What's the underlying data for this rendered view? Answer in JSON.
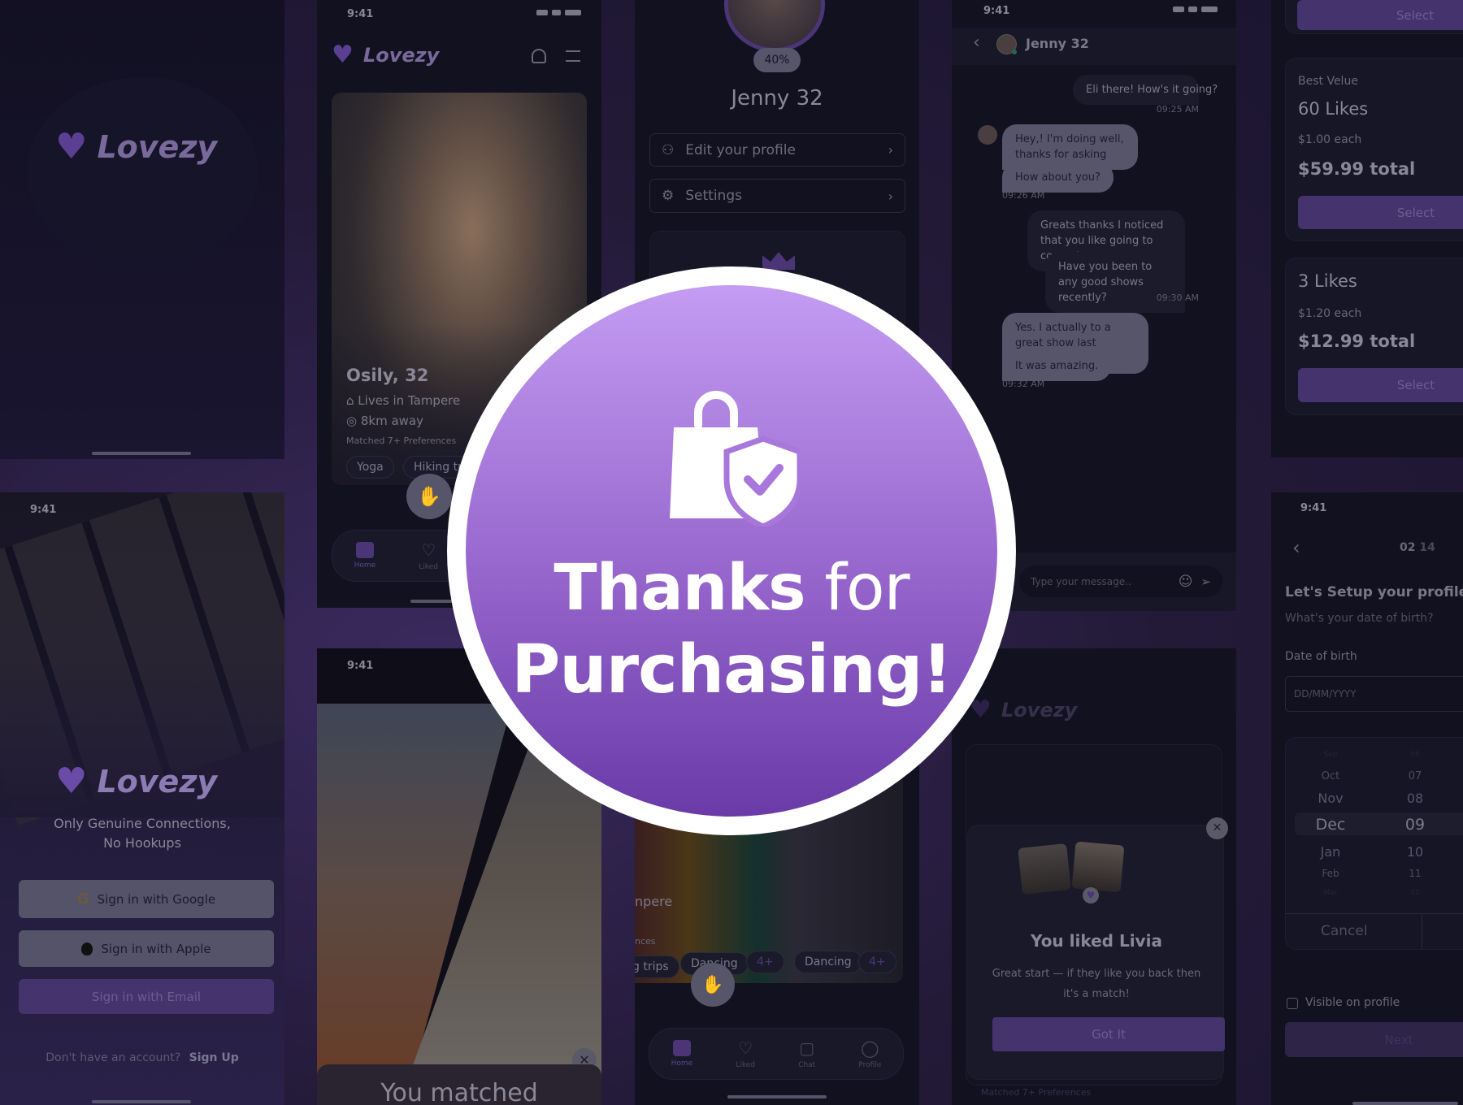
{
  "brand": {
    "name": "Lovezy",
    "accent": "#4b3577",
    "circle_top": "#c49cf2",
    "circle_bottom": "#6a3aa8"
  },
  "status_time": "9:41",
  "login": {
    "tagline_1": "Only Genuine Connections,",
    "tagline_2": "No Hookups",
    "google": "Sign in with Google",
    "apple": "Sign in with Apple",
    "email": "Sign in with Email",
    "no_account": "Don't have an account?",
    "sign_up": "Sign Up"
  },
  "home": {
    "name": "Osily, 32",
    "lives": "Lives in Tampere",
    "distance": "8km away",
    "matched": "Matched 7+ Preferences",
    "chips": [
      "Yoga",
      "Hiking trips"
    ],
    "nav": [
      "Home",
      "Liked",
      "Chat",
      "Profile"
    ]
  },
  "match": {
    "title": "You matched"
  },
  "profile": {
    "progress": "40%",
    "name": "Jenny 32",
    "edit": "Edit your profile",
    "settings": "Settings",
    "frag_lives": "npere",
    "frag_pref": "nces",
    "chips": [
      "g trips",
      "Dancing",
      "4+",
      "Dancing",
      "4+"
    ]
  },
  "chat": {
    "contact": "Jenny 32",
    "messages": [
      {
        "side": "r",
        "text": "Eli there! How's it going?"
      },
      {
        "side": "l",
        "text": "Hey,! I'm doing well, thanks for asking"
      },
      {
        "side": "l",
        "text": "How about you?"
      },
      {
        "side": "r",
        "text": "Greats thanks I noticed that you like going to concerts."
      },
      {
        "side": "r",
        "text": "Have you been to any good shows recently?"
      },
      {
        "side": "l",
        "text": "Yes. I actually to a great show last weekend."
      },
      {
        "side": "l",
        "text": "It was amazing."
      }
    ],
    "times": [
      "09:25 AM",
      "09:26 AM",
      "09:30 AM",
      "09:32 AM"
    ],
    "placeholder": "Type your message.."
  },
  "liked": {
    "title": "You liked Livia",
    "desc_1": "Great start — if they like you back then",
    "desc_2": "it's a match!",
    "button": "Got It",
    "matched": "Matched 7+ Preferences"
  },
  "purchase": {
    "select": "Select",
    "plans": [
      {
        "badge": "Best Velue",
        "title": "60 Likes",
        "each": "$1.00 each",
        "total": "$59.99 total"
      },
      {
        "badge": "",
        "title": "3 Likes",
        "each": "$1.20 each",
        "total": "$12.99 total"
      }
    ]
  },
  "setup": {
    "step": "02",
    "total": "14",
    "title": "Let's Setup your profile",
    "subtitle": "What's your date of birth?",
    "label": "Date of birth",
    "placeholder": "DD/MM/YYYY",
    "months": [
      "Sep",
      "Oct",
      "Nov",
      "Dec",
      "Jan",
      "Feb",
      "Mar"
    ],
    "days": [
      "06",
      "07",
      "08",
      "09",
      "10",
      "11",
      "12"
    ],
    "selected": "Dec 09",
    "cancel": "Cancel",
    "visible": "Visible on profile",
    "visible_checked": false,
    "next": "Next"
  },
  "hero": {
    "line1_bold": "Thanks",
    "line1_light": "for",
    "line2": "Purchasing!",
    "icon": "shopping-bag-shield-check-icon"
  }
}
